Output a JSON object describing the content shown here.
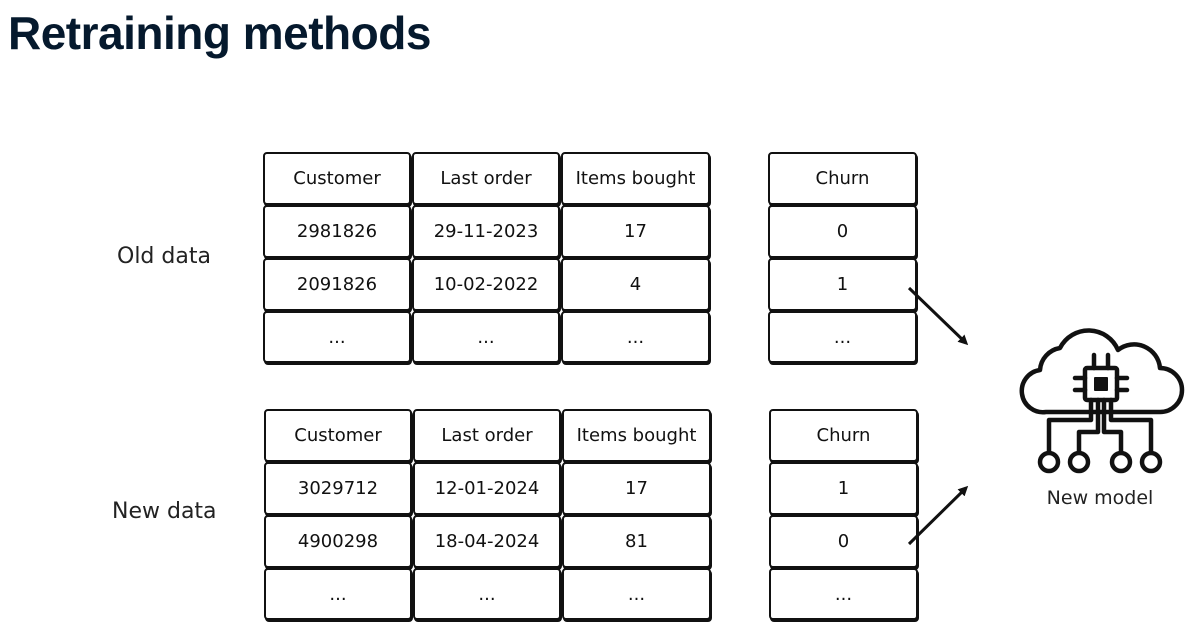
{
  "title": "Retraining methods",
  "old_data": {
    "label": "Old data",
    "headers": [
      "Customer",
      "Last order",
      "Items bought"
    ],
    "target_header": "Churn",
    "rows": [
      [
        "2981826",
        "29-11-2023",
        "17"
      ],
      [
        "2091826",
        "10-02-2022",
        "4"
      ],
      [
        "...",
        "...",
        "..."
      ]
    ],
    "target_values": [
      "0",
      "1",
      "..."
    ]
  },
  "new_data": {
    "label": "New data",
    "headers": [
      "Customer",
      "Last order",
      "Items bought"
    ],
    "target_header": "Churn",
    "rows": [
      [
        "3029712",
        "12-01-2024",
        "17"
      ],
      [
        "4900298",
        "18-04-2024",
        "81"
      ],
      [
        "...",
        "...",
        "..."
      ]
    ],
    "target_values": [
      "1",
      "0",
      "..."
    ]
  },
  "model": {
    "label": "New model",
    "icon": "cloud-chip-icon"
  },
  "colors": {
    "title": "#05192d",
    "border": "#111111",
    "text": "#111111"
  }
}
